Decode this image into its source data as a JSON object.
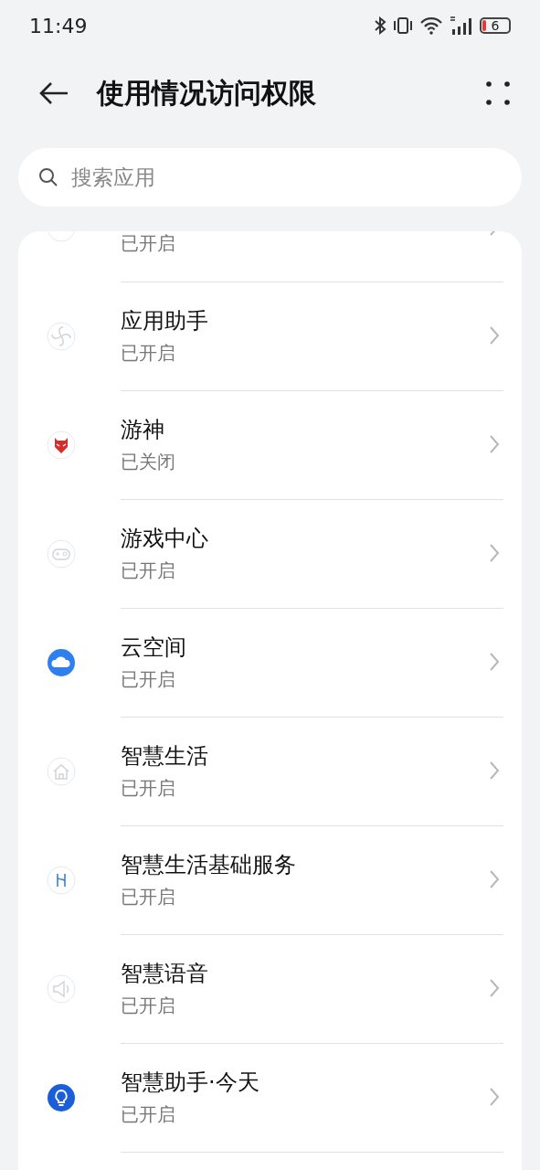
{
  "status_bar": {
    "time": "11:49",
    "battery": "6"
  },
  "header": {
    "title": "使用情况访问权限"
  },
  "search": {
    "placeholder": "搜索应用"
  },
  "apps": [
    {
      "status": "已开启"
    },
    {
      "name": "应用助手",
      "status": "已开启"
    },
    {
      "name": "游神",
      "status": "已关闭"
    },
    {
      "name": "游戏中心",
      "status": "已开启"
    },
    {
      "name": "云空间",
      "status": "已开启"
    },
    {
      "name": "智慧生活",
      "status": "已开启"
    },
    {
      "name": "智慧生活基础服务",
      "status": "已开启"
    },
    {
      "name": "智慧语音",
      "status": "已开启"
    },
    {
      "name": "智慧助手·今天",
      "status": "已开启"
    }
  ]
}
